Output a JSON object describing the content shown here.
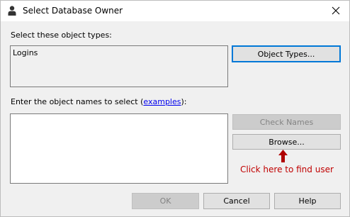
{
  "window": {
    "title": "Select Database Owner",
    "icon": "user-icon",
    "close_icon": "close-icon"
  },
  "object_types": {
    "label": "Select these object types:",
    "items": [
      "Logins"
    ],
    "button_label": "Object Types..."
  },
  "object_names": {
    "label_prefix": "Enter the object names to select (",
    "link_text": "examples",
    "label_suffix": "):",
    "value": ""
  },
  "buttons": {
    "check_names": "Check Names",
    "browse": "Browse...",
    "ok": "OK",
    "cancel": "Cancel",
    "help": "Help"
  },
  "annotation": {
    "text": "Click here to find user",
    "color": "#c00000"
  }
}
